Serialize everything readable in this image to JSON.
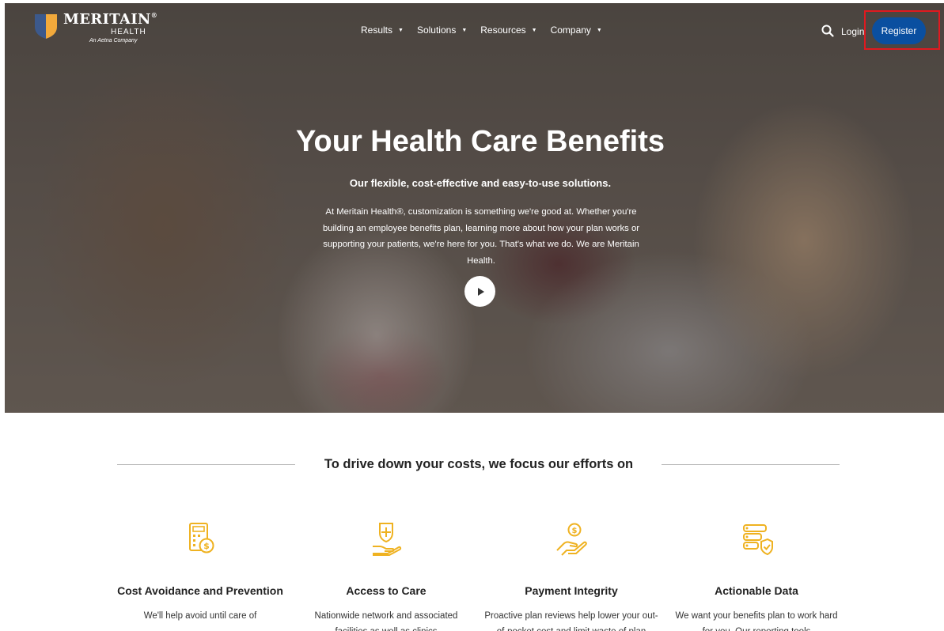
{
  "brand": {
    "name": "MERITAIN",
    "registered": "®",
    "sub": "HEALTH",
    "tagline": "An Aetna Company",
    "colors": {
      "shield_blue": "#1b3d78",
      "shield_gold": "#f2a93b",
      "primary": "#0a4fa0",
      "icon_gold": "#efb221"
    }
  },
  "nav": {
    "items": [
      {
        "label": "Results"
      },
      {
        "label": "Solutions"
      },
      {
        "label": "Resources"
      },
      {
        "label": "Company"
      }
    ],
    "login": "Login",
    "register": "Register"
  },
  "hero": {
    "title": "Your Health Care Benefits",
    "subtitle": "Our flexible, cost-effective and easy-to-use solutions.",
    "body": "At Meritain Health®, customization is something we're good at. Whether you're building an employee benefits plan, learning more about how your plan works or supporting your patients, we're here for you. That's what we do. We are Meritain Health."
  },
  "focus": {
    "heading": "To drive down your costs, we focus our efforts on",
    "cards": [
      {
        "icon": "calculator-dollar-icon",
        "title": "Cost Avoidance and Prevention",
        "text": "We'll help avoid until care of"
      },
      {
        "icon": "hand-shield-cross-icon",
        "title": "Access to Care",
        "text": "Nationwide network and associated facilities as well as clinics"
      },
      {
        "icon": "hand-dollar-icon",
        "title": "Payment Integrity",
        "text": "Proactive plan reviews help lower your out-of-pocket cost and limit waste of plan"
      },
      {
        "icon": "data-checklist-icon",
        "title": "Actionable Data",
        "text": "We want your benefits plan to work hard for you. Our reporting tools"
      }
    ]
  }
}
